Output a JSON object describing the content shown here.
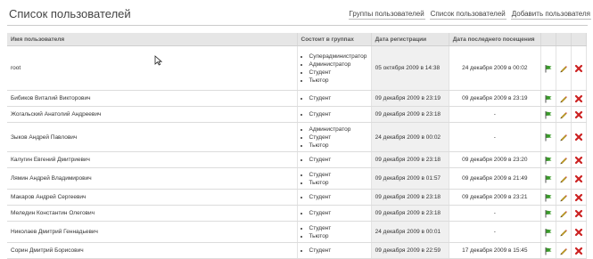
{
  "page": {
    "title": "Список пользователей",
    "links": [
      "Группы пользователей",
      "Список пользователей",
      "Добавить пользователя"
    ]
  },
  "table": {
    "headers": {
      "name": "Имя пользователя",
      "groups": "Состоит в группах",
      "registered": "Дата регистрации",
      "last_visit": "Дата последнего посещения"
    },
    "rows": [
      {
        "name": "root",
        "groups": [
          "Суперадминистратор",
          "Администратор",
          "Студент",
          "Тьютор"
        ],
        "registered": "05 октября 2009 в 14:38",
        "last_visit": "24 декабря 2009 в 00:02"
      },
      {
        "name": "Бибиков Виталий Викторович",
        "groups": [
          "Студент"
        ],
        "registered": "09 декабря 2009 в 23:19",
        "last_visit": "09 декабря 2009 в 23:19"
      },
      {
        "name": "Жогальский Анатолий Андреевич",
        "groups": [
          "Студент"
        ],
        "registered": "09 декабря 2009 в 23:18",
        "last_visit": "-"
      },
      {
        "name": "Зыков Андрей Павлович",
        "groups": [
          "Администратор",
          "Студент",
          "Тьютор"
        ],
        "registered": "24 декабря 2009 в 00:02",
        "last_visit": "-"
      },
      {
        "name": "Калугин Евгений Дмитриевич",
        "groups": [
          "Студент"
        ],
        "registered": "09 декабря 2009 в 23:18",
        "last_visit": "09 декабря 2009 в 23:20"
      },
      {
        "name": "Лямин Андрей Владимирович",
        "groups": [
          "Студент",
          "Тьютор"
        ],
        "registered": "09 декабря 2009 в 01:57",
        "last_visit": "09 декабря 2009 в 21:49"
      },
      {
        "name": "Макаров Андрей Сергеевич",
        "groups": [
          "Студент"
        ],
        "registered": "09 декабря 2009 в 23:18",
        "last_visit": "09 декабря 2009 в 23:21"
      },
      {
        "name": "Меледин Константин Олегович",
        "groups": [
          "Студент"
        ],
        "registered": "09 декабря 2009 в 23:18",
        "last_visit": "-"
      },
      {
        "name": "Николаев Дмитрий Геннадьевич",
        "groups": [
          "Студент",
          "Тьютор"
        ],
        "registered": "24 декабря 2009 в 00:01",
        "last_visit": "-"
      },
      {
        "name": "Сорин Дмитрий Борисович",
        "groups": [
          "Студент"
        ],
        "registered": "09 декабря 2009 в 22:59",
        "last_visit": "17 декабря 2009 в 15:45"
      }
    ],
    "actions": [
      "flag-icon",
      "pencil-icon",
      "delete-icon"
    ]
  },
  "colors": {
    "flag": "#3a9a2a",
    "pencil": "#c9a227",
    "delete": "#cc2222",
    "header_bg": "#e6e6e6"
  }
}
